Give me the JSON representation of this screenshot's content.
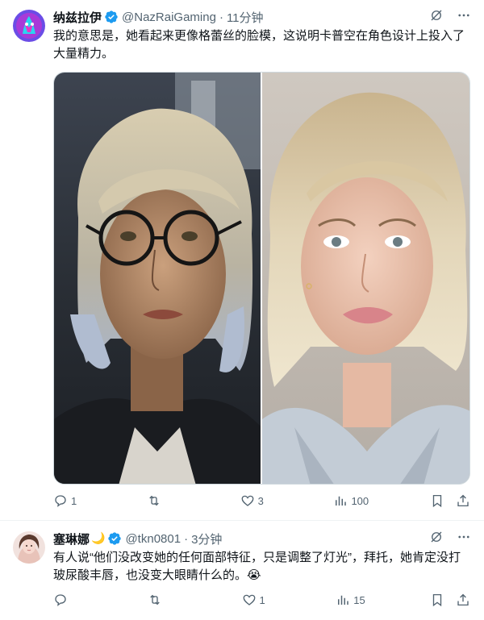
{
  "tweets": [
    {
      "display_name": "纳兹拉伊",
      "handle": "@NazRaiGaming",
      "separator": "·",
      "time": "11分钟",
      "text": "我的意思是，她看起来更像格蕾丝的脸模，这说明卡普空在角色设计上投入了大量精力。",
      "media": [
        {
          "description_icon": "game-character-render"
        },
        {
          "description_icon": "face-model-photo"
        }
      ],
      "actions": {
        "replies": "1",
        "retweets": "",
        "likes": "3",
        "views": "100"
      }
    },
    {
      "display_name": "塞琳娜",
      "name_emoji": "🌙",
      "handle": "@tkn0801",
      "separator": "·",
      "time": "3分钟",
      "text": "有人说“他们没改变她的任何面部特征，只是调整了灯光”，拜托，她肯定没打玻尿酸丰唇，也没变大眼睛什么的。😭",
      "actions": {
        "replies": "",
        "retweets": "",
        "likes": "1",
        "views": "15"
      }
    }
  ],
  "colors": {
    "verified": "#1d9bf0",
    "muted": "#536471",
    "text": "#0f1419",
    "border": "#eff3f4"
  }
}
